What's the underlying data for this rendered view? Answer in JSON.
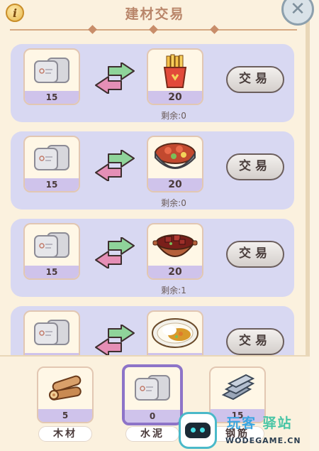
{
  "header": {
    "title": "建材交易",
    "info_label": "i",
    "close_label": "✕"
  },
  "trades": [
    {
      "give_item": "cement-bag",
      "give_qty": "15",
      "get_item": "fries",
      "get_qty": "20",
      "remaining": "剩余:0",
      "button": "交易"
    },
    {
      "give_item": "cement-bag",
      "give_qty": "15",
      "get_item": "stew",
      "get_qty": "20",
      "remaining": "剩余:0",
      "button": "交易"
    },
    {
      "give_item": "cement-bag",
      "give_qty": "15",
      "get_item": "braised-pork",
      "get_qty": "20",
      "remaining": "剩余:1",
      "button": "交易"
    },
    {
      "give_item": "cement-bag",
      "give_qty": "",
      "get_item": "curry-rice",
      "get_qty": "",
      "remaining": "",
      "button": "交易"
    }
  ],
  "materials": [
    {
      "name": "木材",
      "count": "5",
      "icon": "wood-logs",
      "selected": false
    },
    {
      "name": "水泥",
      "count": "0",
      "icon": "cement-bag",
      "selected": true
    },
    {
      "name": "钢筋",
      "count": "15",
      "icon": "steel-bars",
      "selected": false
    }
  ],
  "watermark": {
    "cn_a": "玩客",
    "cn_b": "驿站",
    "en": "WODEGAME.CN"
  },
  "colors": {
    "row_bg": "#d8d8f2",
    "count_bar": "#cfc3eb",
    "selected_border": "#8d74c8",
    "arrow_green": "#8fd49a",
    "arrow_pink": "#e58fb6"
  }
}
